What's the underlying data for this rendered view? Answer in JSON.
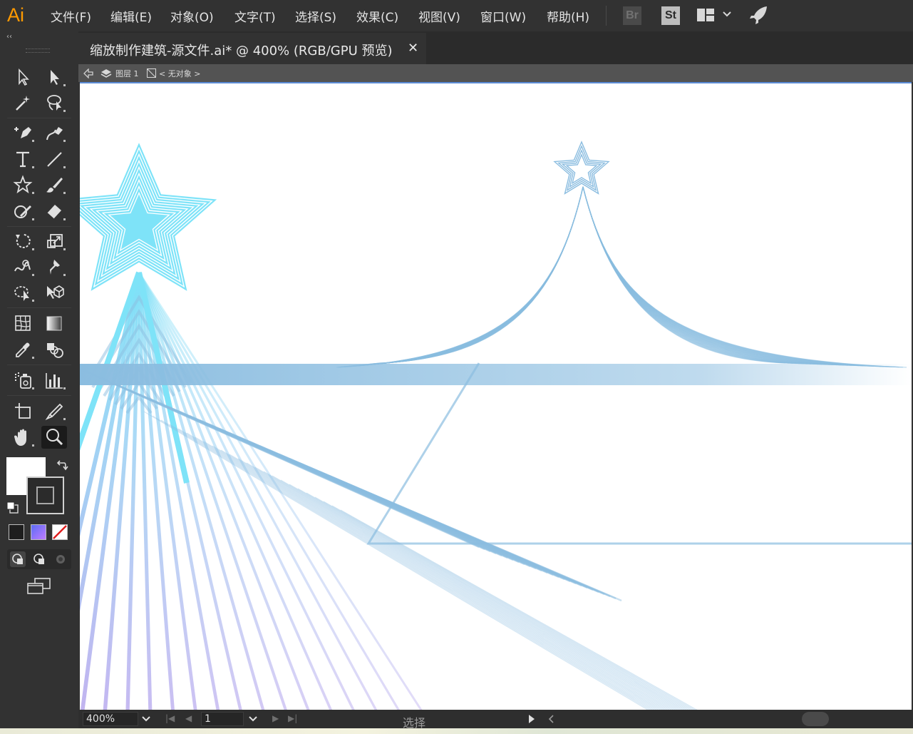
{
  "app": {
    "logo_text": "Ai",
    "accent_color": "#ff9a00"
  },
  "menu": {
    "items": [
      "文件(F)",
      "编辑(E)",
      "对象(O)",
      "文字(T)",
      "选择(S)",
      "效果(C)",
      "视图(V)",
      "窗口(W)",
      "帮助(H)"
    ],
    "bridge_badge": "Br",
    "stock_badge": "St",
    "icons": [
      "workspace-layout-icon",
      "chevron-down-icon",
      "rocket-icon"
    ]
  },
  "document": {
    "tab_title": "缩放制作建筑-源文件.ai* @ 400% (RGB/GPU 预览)",
    "close_glyph": "✕"
  },
  "isolation_bar": {
    "layer_label": "图层 1",
    "object_label": "< 无对象 >"
  },
  "toolbar": {
    "collapse_glyph": "‹‹",
    "tools": [
      "selection-tool-icon",
      "direct-selection-tool-icon",
      "magic-wand-tool-icon",
      "lasso-tool-icon",
      "pen-tool-icon",
      "curvature-tool-icon",
      "type-tool-icon",
      "line-segment-tool-icon",
      "star-tool-icon",
      "paintbrush-tool-icon",
      "shaper-tool-icon",
      "eraser-tool-icon",
      "rotate-tool-icon",
      "scale-tool-icon",
      "warp-tool-icon",
      "puppet-warp-tool-icon",
      "free-transform-tool-icon",
      "shape-builder-tool-icon",
      "mesh-tool-icon",
      "gradient-tool-icon",
      "eyedropper-tool-icon",
      "blend-tool-icon",
      "symbol-sprayer-tool-icon",
      "column-graph-tool-icon",
      "artboard-tool-icon",
      "slice-tool-icon",
      "hand-tool-icon",
      "zoom-tool-icon"
    ],
    "active_tool": "zoom-tool-icon",
    "fill_color": "#ffffff",
    "stroke_color": "#2b2b2b"
  },
  "status": {
    "zoom": "400%",
    "artboard_number": "1",
    "status_label": "选择"
  },
  "artwork": {
    "left_star_color": "#7ee3f8",
    "right_star_color": "#8bbde0",
    "ray_color": "#8bbde0",
    "ray_gradient_end": "#b7a7ee"
  }
}
